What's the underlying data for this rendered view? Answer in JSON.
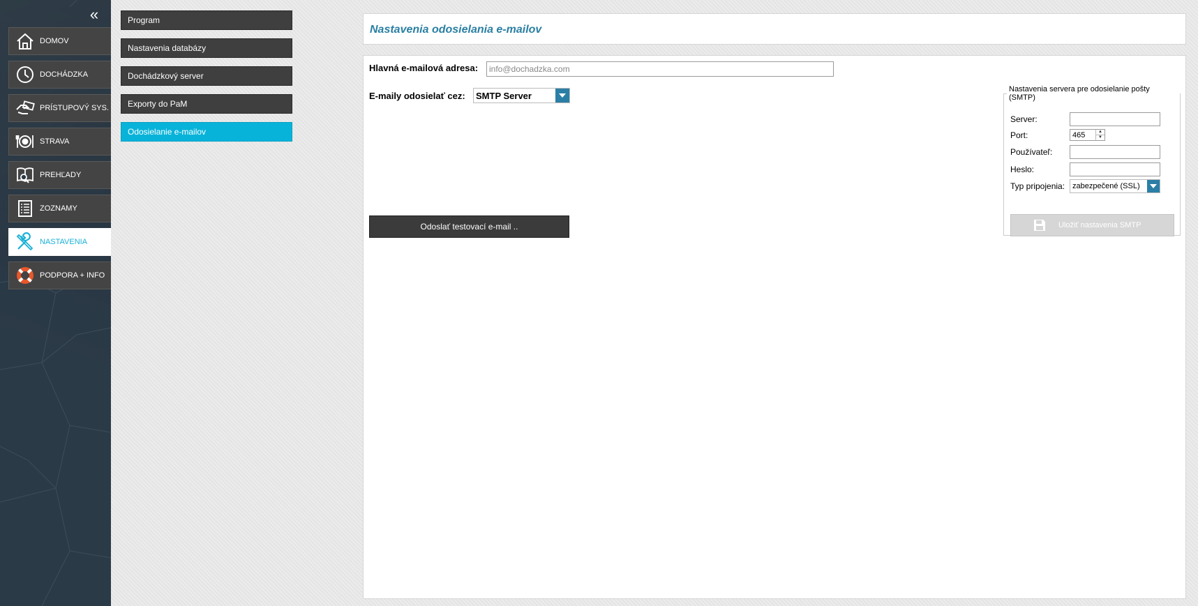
{
  "nav": {
    "collapse_glyph": "«",
    "items": [
      {
        "label": "DOMOV",
        "icon": "home-icon"
      },
      {
        "label": "DOCHÁDZKA",
        "icon": "clock-icon"
      },
      {
        "label": "PRÍSTUPOVÝ SYS.",
        "icon": "access-card-icon"
      },
      {
        "label": "STRAVA",
        "icon": "plate-cutlery-icon"
      },
      {
        "label": "PREHĽADY",
        "icon": "book-search-icon"
      },
      {
        "label": "ZOZNAMY",
        "icon": "list-icon"
      },
      {
        "label": "NASTAVENIA",
        "icon": "tools-icon",
        "active": true
      },
      {
        "label": "PODPORA + INFO",
        "icon": "lifebuoy-icon"
      }
    ]
  },
  "submenu": {
    "items": [
      {
        "label": "Program"
      },
      {
        "label": "Nastavenia databázy"
      },
      {
        "label": "Dochádzkový server"
      },
      {
        "label": "Exporty do PaM"
      },
      {
        "label": "Odosielanie e-mailov",
        "active": true
      }
    ]
  },
  "page": {
    "title": "Nastavenia odosielania e-mailov"
  },
  "form": {
    "main_email_label": "Hlavná e-mailová adresa:",
    "main_email_placeholder": "info@dochadzka.com",
    "send_via_label": "E-maily odosielať cez:",
    "send_via_value": "SMTP Server",
    "test_button": "Odoslať testovací e-mail .."
  },
  "smtp": {
    "legend": "Nastavenia servera pre odosielanie pošty (SMTP)",
    "server_label": "Server:",
    "server_value": "",
    "port_label": "Port:",
    "port_value": "465",
    "user_label": "Používateľ:",
    "user_value": "",
    "password_label": "Heslo:",
    "password_value": "",
    "conn_type_label": "Typ pripojenia:",
    "conn_type_value": "zabezpečené (SSL)",
    "save_button": "Uložiť nastavenia SMTP"
  },
  "colors": {
    "accent": "#08b3d9",
    "title": "#2a7fa3",
    "dropdown": "#2b7fa6"
  }
}
